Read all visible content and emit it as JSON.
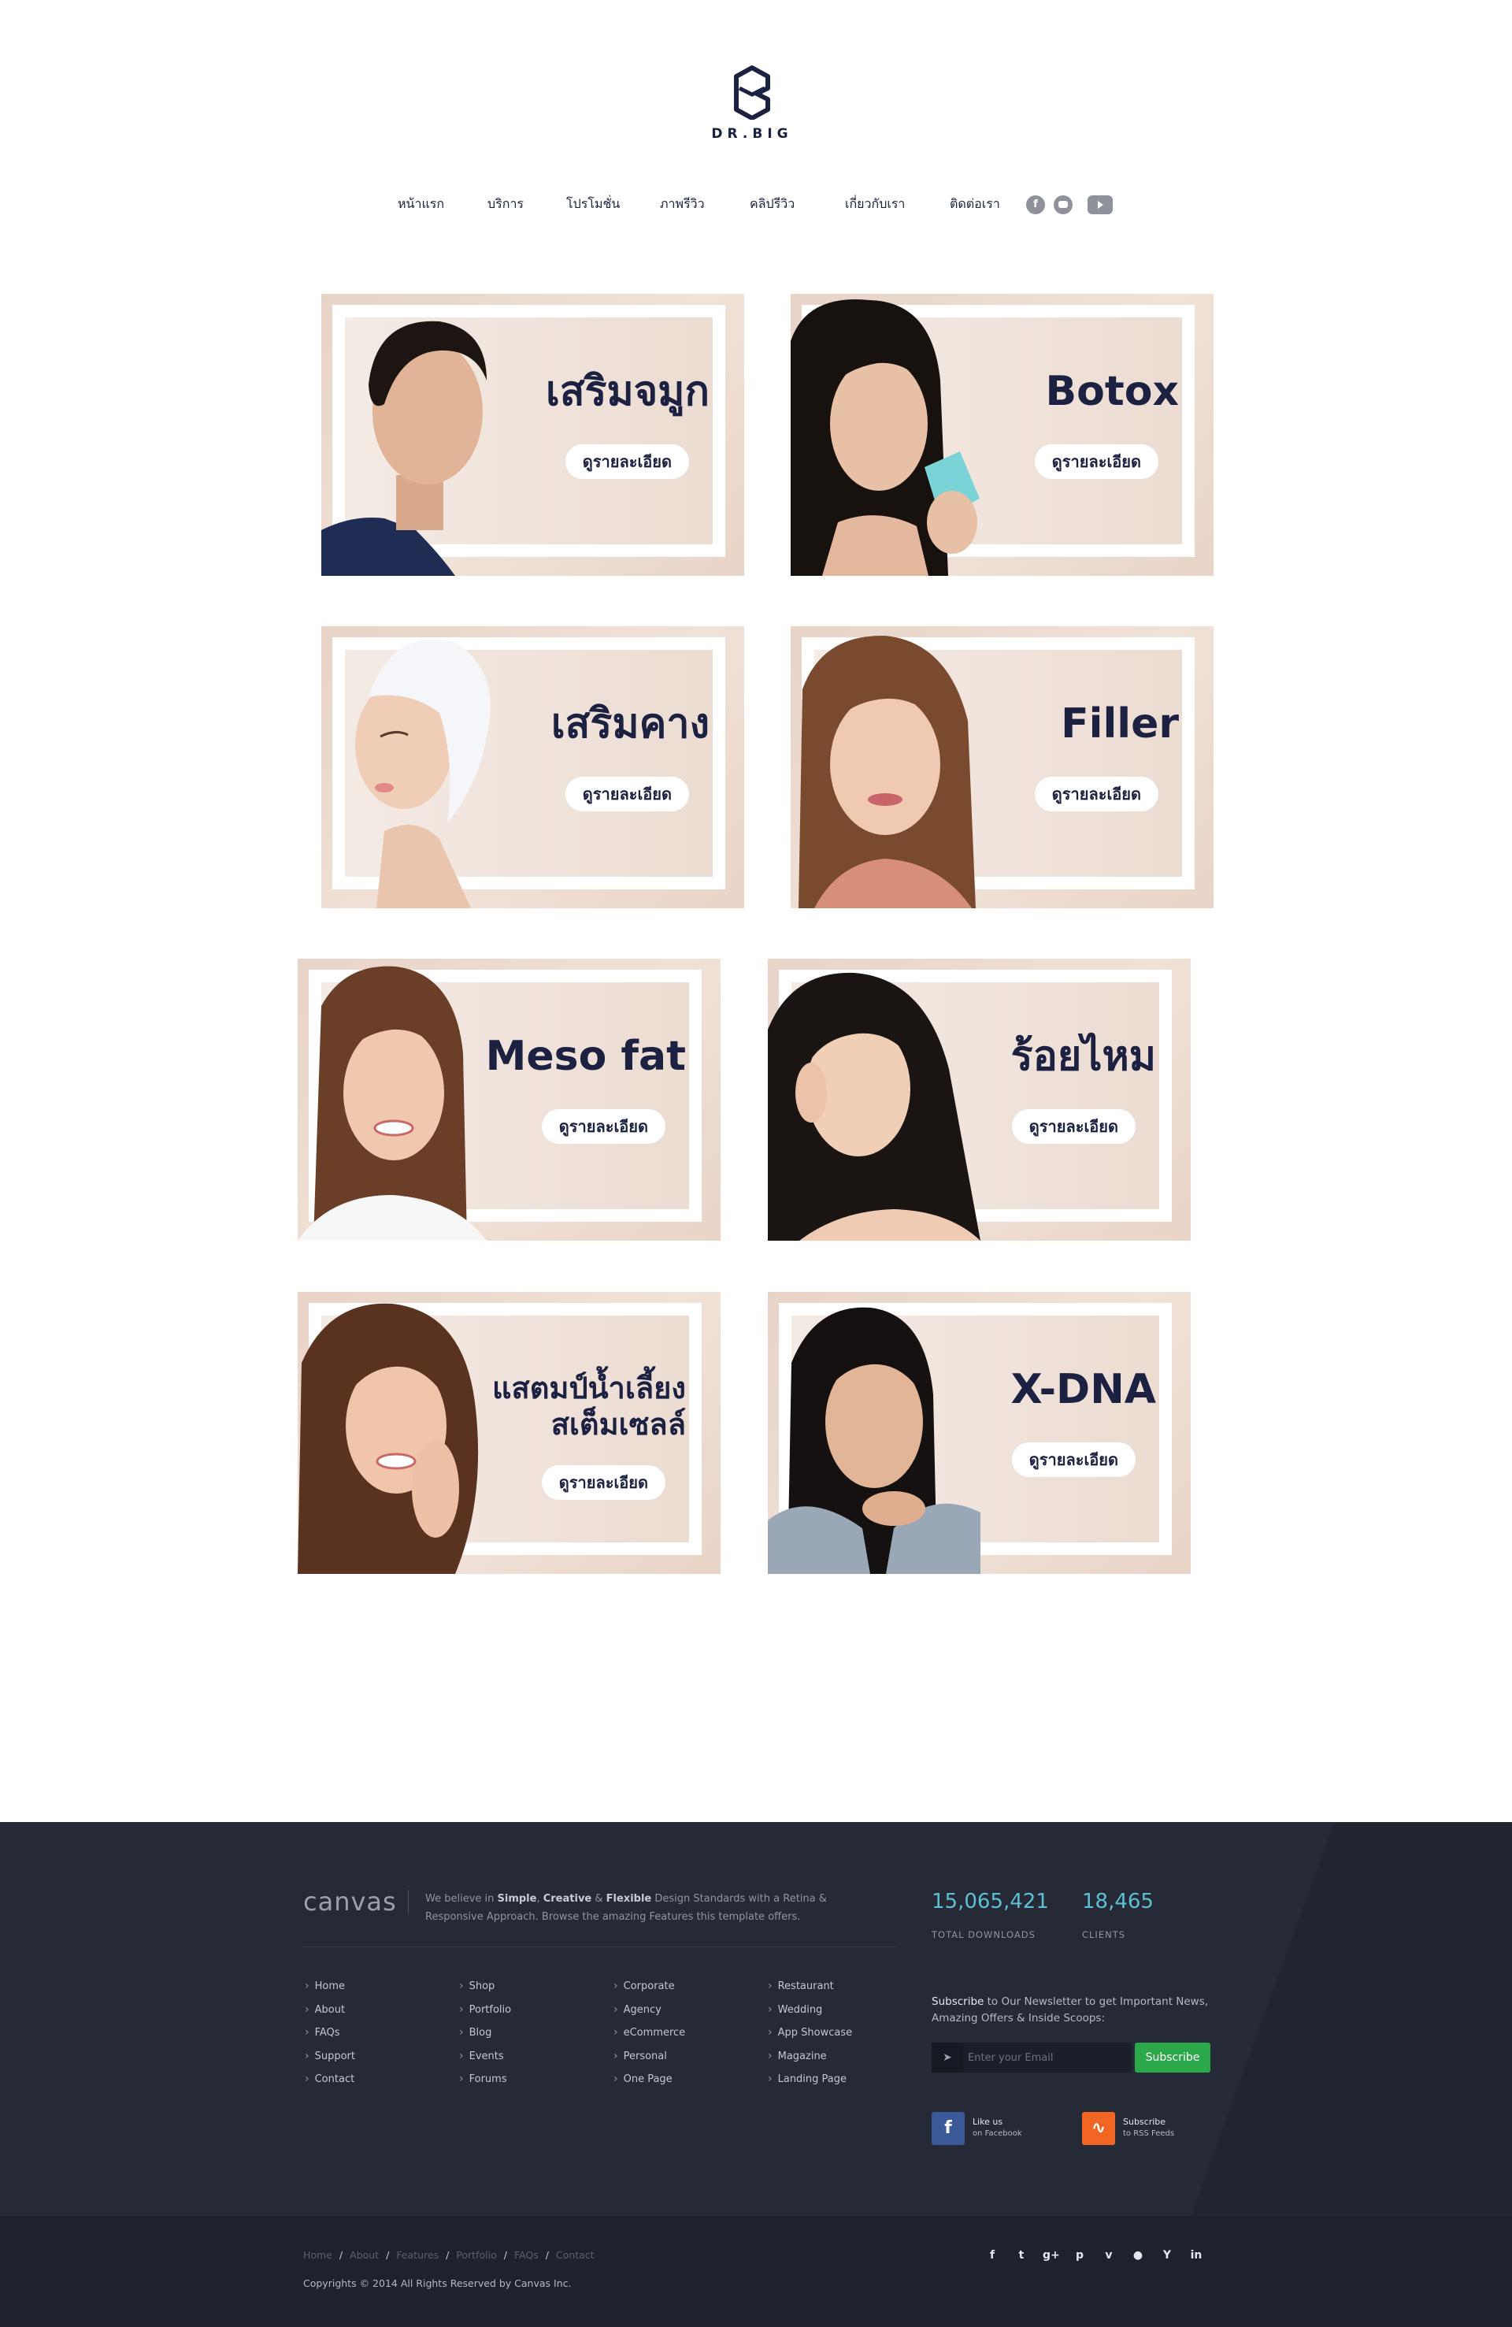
{
  "header": {
    "logo_text": "DR.BIG",
    "nav": [
      {
        "label": "หน้าแรก"
      },
      {
        "label": "บริการ"
      },
      {
        "label": "โปรโมชั่น"
      },
      {
        "label": "ภาพรีวิว"
      },
      {
        "label": "คลิปรีวิว"
      },
      {
        "label": "เกี่ยวกับเรา"
      },
      {
        "label": "ติดต่อเรา"
      }
    ],
    "social_icons": [
      "facebook-icon",
      "line-icon",
      "youtube-icon"
    ]
  },
  "services": [
    {
      "title": "เสริมจมูก",
      "button": "ดูรายละเอียด"
    },
    {
      "title": "Botox",
      "button": "ดูรายละเอียด"
    },
    {
      "title": "เสริมคาง",
      "button": "ดูรายละเอียด"
    },
    {
      "title": "Filler",
      "button": "ดูรายละเอียด"
    },
    {
      "title": "Meso fat",
      "button": "ดูรายละเอียด"
    },
    {
      "title": "ร้อยไหม",
      "button": "ดูรายละเอียด"
    },
    {
      "title_line1": "แสตมป์น้ำเลี้ยง",
      "title_line2": "สเต็มเซลล์",
      "button": "ดูรายละเอียด"
    },
    {
      "title": "X-DNA",
      "button": "ดูรายละเอียด"
    }
  ],
  "footer": {
    "brand": "canvas",
    "tagline": {
      "t1": "We believe in ",
      "b1": "Simple",
      "t2": ", ",
      "b2": "Creative",
      "t3": " & ",
      "b3": "Flexible",
      "t4": " Design Standards with a Retina & Responsive Approach. Browse the amazing Features this template offers."
    },
    "columns": [
      [
        "Home",
        "About",
        "FAQs",
        "Support",
        "Contact"
      ],
      [
        "Shop",
        "Portfolio",
        "Blog",
        "Events",
        "Forums"
      ],
      [
        "Corporate",
        "Agency",
        "eCommerce",
        "Personal",
        "One Page"
      ],
      [
        "Restaurant",
        "Wedding",
        "App Showcase",
        "Magazine",
        "Landing Page"
      ]
    ],
    "stats": [
      {
        "value": "15,065,421",
        "label": "TOTAL DOWNLOADS"
      },
      {
        "value": "18,465",
        "label": "CLIENTS"
      }
    ],
    "newsletter": {
      "lead": "Subscribe",
      "text": " to Our Newsletter to get Important News, Amazing Offers & Inside Scoops:",
      "placeholder": "Enter your Email",
      "button": "Subscribe"
    },
    "social": [
      {
        "line1": "Like us",
        "line2": "on Facebook",
        "color": "#3b5998",
        "icon": "facebook-icon"
      },
      {
        "line1": "Subscribe",
        "line2": "to RSS Feeds",
        "color": "#f26522",
        "icon": "rss-icon"
      }
    ],
    "bottom_links": [
      "Home",
      "About",
      "Features",
      "Portfolio",
      "FAQs",
      "Contact"
    ],
    "copyright": "Copyrights © 2014 All Rights Reserved by Canvas Inc.",
    "bottom_icons": [
      "facebook-icon",
      "twitter-icon",
      "google-plus-icon",
      "pinterest-icon",
      "vimeo-icon",
      "github-icon",
      "yahoo-icon",
      "linkedin-icon"
    ]
  }
}
